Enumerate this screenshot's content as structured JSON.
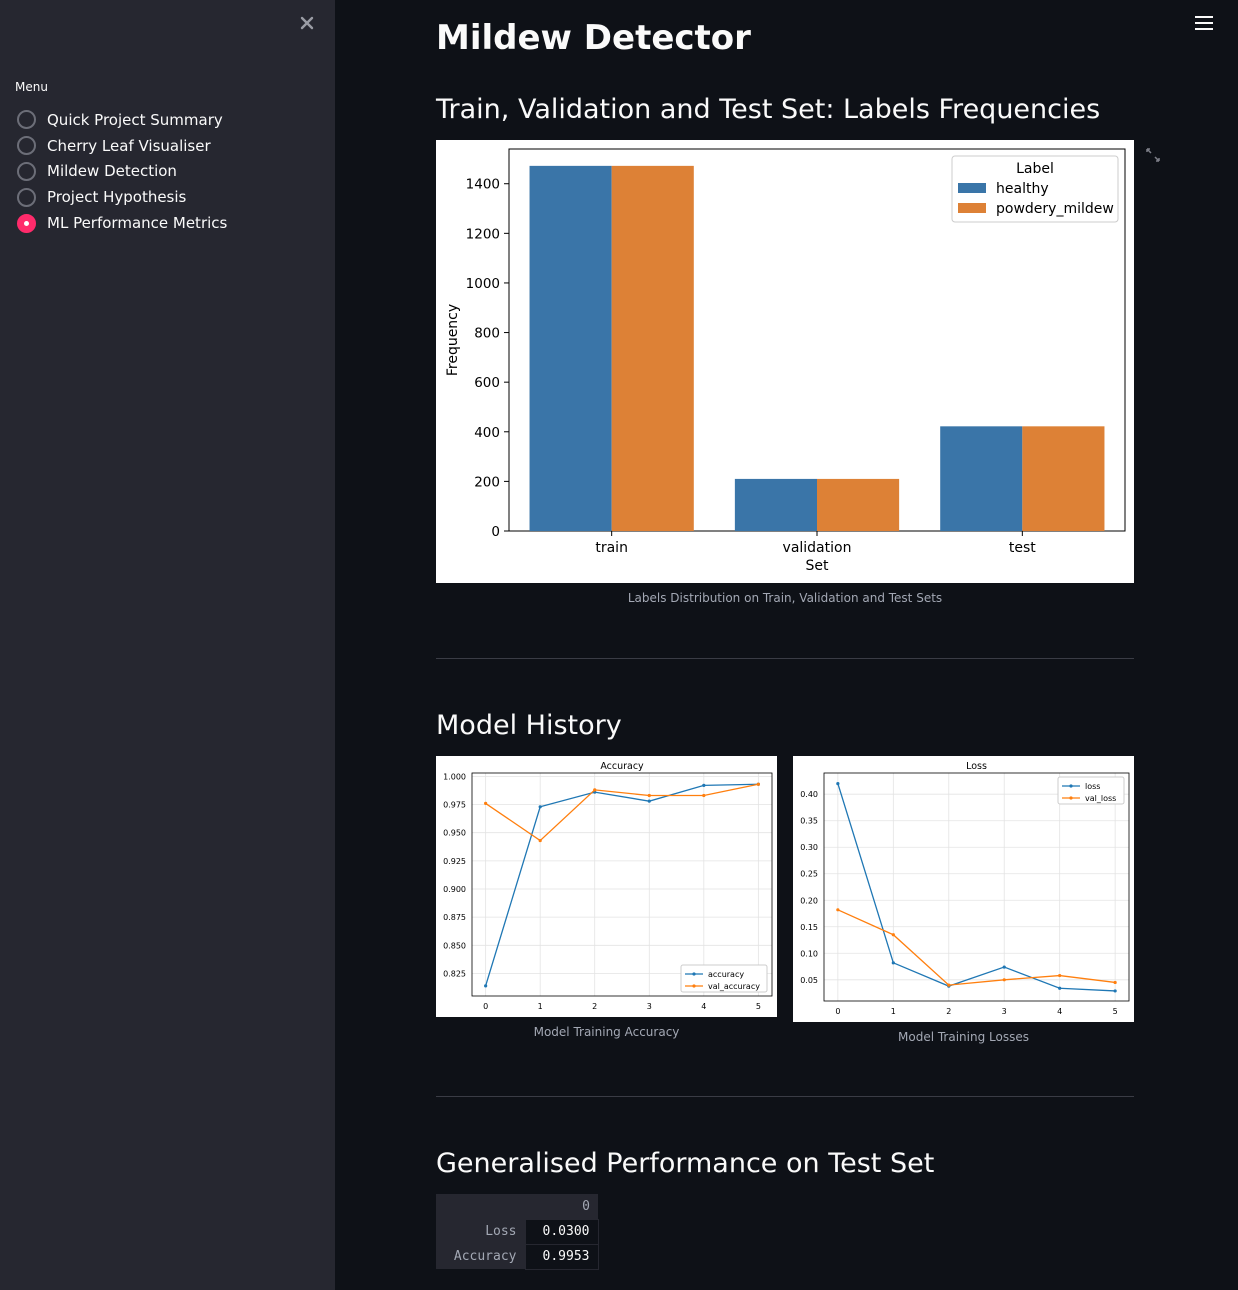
{
  "sidebar": {
    "menu_label": "Menu",
    "items": [
      {
        "label": "Quick Project Summary",
        "selected": false
      },
      {
        "label": "Cherry Leaf Visualiser",
        "selected": false
      },
      {
        "label": "Mildew Detection",
        "selected": false
      },
      {
        "label": "Project Hypothesis",
        "selected": false
      },
      {
        "label": "ML Performance Metrics",
        "selected": true
      }
    ],
    "accent_color": "#ff2b6b"
  },
  "page": {
    "title": "Mildew Detector",
    "section_labels": "Train, Validation and Test Set: Labels Frequencies",
    "labels_caption": "Labels Distribution on Train, Validation and Test Sets",
    "section_history": "Model History",
    "accuracy_caption": "Model Training Accuracy",
    "loss_caption": "Model Training Losses",
    "section_performance": "Generalised Performance on Test Set"
  },
  "performance_table": {
    "column_header": "0",
    "rows": [
      {
        "label": "Loss",
        "value": "0.0300"
      },
      {
        "label": "Accuracy",
        "value": "0.9953"
      }
    ]
  },
  "chart_data": [
    {
      "type": "bar",
      "categories": [
        "train",
        "validation",
        "test"
      ],
      "series": [
        {
          "name": "healthy",
          "values": [
            1472,
            210,
            422
          ],
          "color": "#3a75a8"
        },
        {
          "name": "powdery_mildew",
          "values": [
            1472,
            210,
            422
          ],
          "color": "#dd8136"
        }
      ],
      "xlabel": "Set",
      "ylabel": "Frequency",
      "ylim": [
        0,
        1540
      ],
      "yticks": [
        0,
        200,
        400,
        600,
        800,
        1000,
        1200,
        1400
      ],
      "legend_title": "Label",
      "legend_position": "top-right",
      "grid": false
    },
    {
      "type": "line",
      "title": "Accuracy",
      "x": [
        0,
        1,
        2,
        3,
        4,
        5
      ],
      "series": [
        {
          "name": "accuracy",
          "values": [
            0.814,
            0.973,
            0.986,
            0.978,
            0.992,
            0.993
          ],
          "color": "#1f77b4"
        },
        {
          "name": "val_accuracy",
          "values": [
            0.976,
            0.943,
            0.988,
            0.983,
            0.983,
            0.993
          ],
          "color": "#ff7f0e"
        }
      ],
      "xticks": [
        0,
        1,
        2,
        3,
        4,
        5
      ],
      "yticks": [
        0.825,
        0.85,
        0.875,
        0.9,
        0.925,
        0.95,
        0.975,
        1.0
      ],
      "ylim": [
        0.805,
        1.003
      ],
      "xlim": [
        -0.25,
        5.25
      ],
      "legend_position": "lower-right",
      "grid": true
    },
    {
      "type": "line",
      "title": "Loss",
      "x": [
        0,
        1,
        2,
        3,
        4,
        5
      ],
      "series": [
        {
          "name": "loss",
          "values": [
            0.42,
            0.082,
            0.038,
            0.074,
            0.034,
            0.029
          ],
          "color": "#1f77b4"
        },
        {
          "name": "val_loss",
          "values": [
            0.182,
            0.135,
            0.04,
            0.05,
            0.058,
            0.045
          ],
          "color": "#ff7f0e"
        }
      ],
      "xticks": [
        0,
        1,
        2,
        3,
        4,
        5
      ],
      "yticks": [
        0.05,
        0.1,
        0.15,
        0.2,
        0.25,
        0.3,
        0.35,
        0.4
      ],
      "ylim": [
        0.01,
        0.44
      ],
      "xlim": [
        -0.25,
        5.25
      ],
      "legend_position": "upper-right",
      "grid": true
    }
  ]
}
